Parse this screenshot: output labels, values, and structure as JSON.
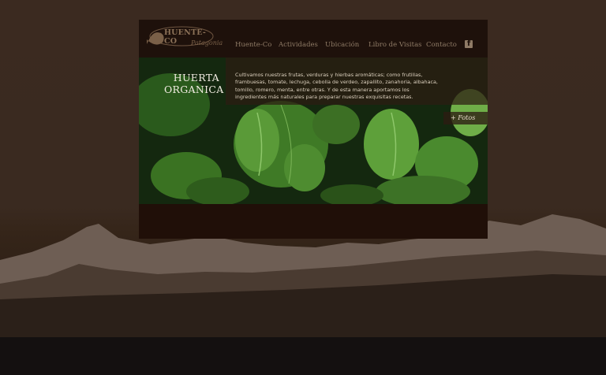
{
  "brand": {
    "name": "HUENTE-CO",
    "tagline": "Patagonia"
  },
  "nav": {
    "items": [
      "Huente-Co",
      "Actividades",
      "Ubicación",
      "Libro de Visitas",
      "Contacto"
    ],
    "social_icon": "facebook-icon"
  },
  "hero": {
    "title_line1": "HUERTA",
    "title_line2": "ORGANICA",
    "description": "Cultivamos nuestras frutas, verduras y hierbas aromáticas; como frutillas, frambuesas, tomate, lechuga, cebolla de verdeo, zapallito, zanahoria, albahaca, tomillo, romero, menta, entre otras. Y de esta manera aportamos los ingredientes más naturales para preparar nuestras exquisitas recetas.",
    "photos_link": "+ Fotos"
  },
  "colors": {
    "page_bg": "#3a2a1f",
    "panel_bg": "#1e110b",
    "nav_text": "#8f7b66",
    "overlay": "#2d1c12"
  }
}
